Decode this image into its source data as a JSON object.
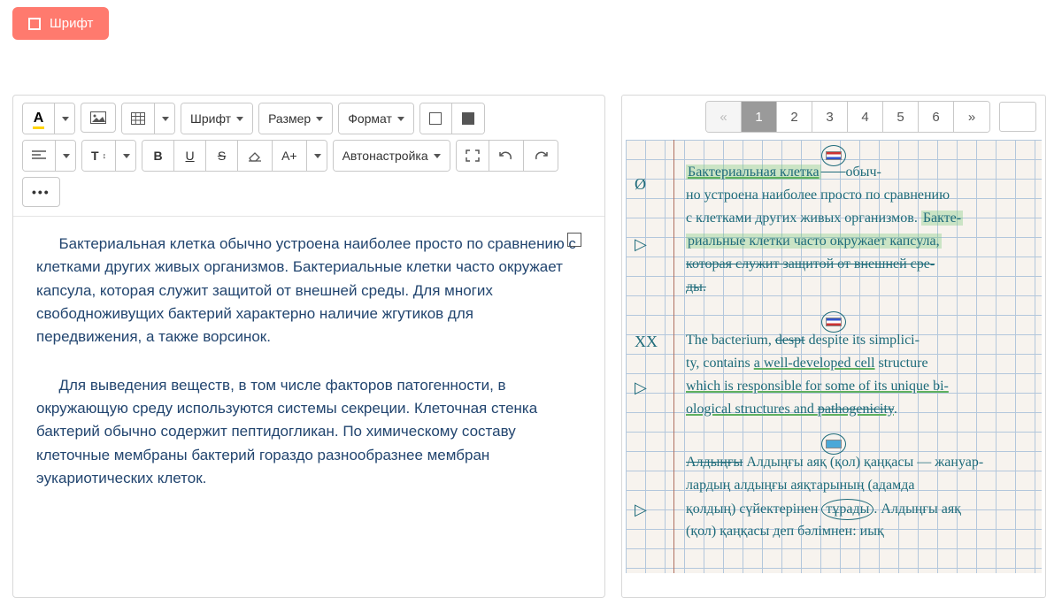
{
  "topbar": {
    "font_button": "Шрифт"
  },
  "toolbar": {
    "font_label": "Шрифт",
    "size_label": "Размер",
    "format_label": "Формат",
    "auto_label": "Автонастройка",
    "bold": "B",
    "underline": "U",
    "strike": "S",
    "case": "A+",
    "textsize": "T",
    "dots": "•••"
  },
  "content": {
    "para1": "Бактериальная клетка обычно устроена наиболее просто по сравнению с клетками других живых организмов. Бактериальные клетки часто окружает капсула, которая служит защитой от внешней среды. Для многих свободноживущих бактерий характерно наличие жгутиков для передвижения, а также ворсинок.",
    "para2": "Для выведения веществ, в том числе факторов патогенности, в окружающую среду используются системы секреции. Клеточная стенка бактерий обычно содержит пептидогликан. По химическому составу клеточные мембраны бактерий гораздо разнообразнее мембран эукариотических клеток."
  },
  "pager": {
    "prev": "«",
    "next": "»",
    "current": 1,
    "pages": [
      "1",
      "2",
      "3",
      "4",
      "5",
      "6"
    ],
    "input_value": ""
  },
  "handwriting": {
    "ru": {
      "l1a": "Бактериальная клетка",
      "l1b": " обыч-",
      "l2": "но устроена наиболее просто по сравнению",
      "l3a": "с клетками других живых организмов. ",
      "l3b": "Бакте-",
      "l4a": "риальные клетки часто окружает капсула,",
      "l5": "которая служит защитой от внешней сре-",
      "l6": "ды."
    },
    "en": {
      "l1a": "The bacterium, ",
      "l1b": "despt",
      "l1c": " despite   its simplici-",
      "l2a": "ty, contains ",
      "l2b": "a well-developed cell",
      "l2c": " structure",
      "l3": "which is responsible for some of its unique bi-",
      "l4a": "ological structures and ",
      "l4b": "pathogenicity",
      "l4c": "."
    },
    "kz": {
      "l1": "Алдыңғы аяқ (қол) қаңқасы  —  жануар-",
      "l2": "лардың алдыңғы аяқтарының (адамда",
      "l3a": "қолдың) сүйектерінен ",
      "l3b": "тұрады",
      "l3c": ". Алдыңғы аяқ",
      "l4": "(қол) қаңқасы деп бәлімнен: иық"
    },
    "margin_marks": {
      "m1": "Ø",
      "m2": "▷",
      "m3": "XX",
      "m4": "▷",
      "m5": "▷"
    }
  }
}
